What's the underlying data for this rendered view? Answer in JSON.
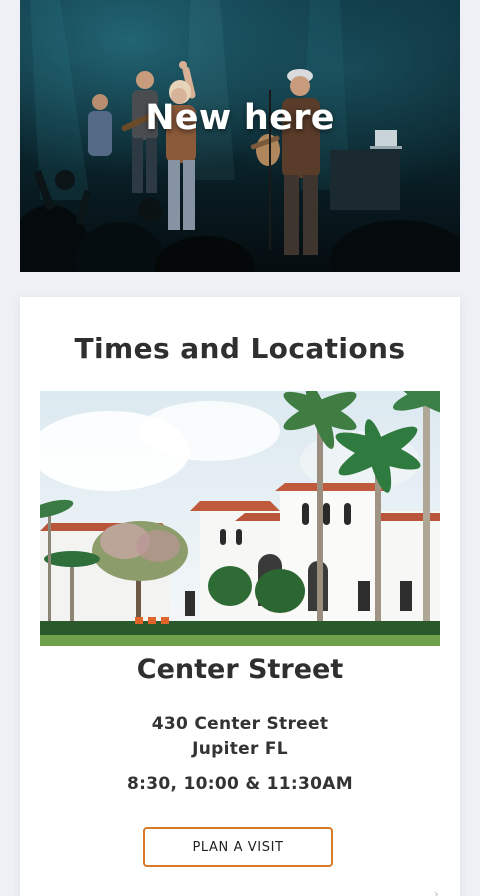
{
  "hero": {
    "title": "New here"
  },
  "locations_section": {
    "title": "Times and Locations",
    "location": {
      "name": "Center Street",
      "address_line1": "430 Center Street",
      "address_line2": "Jupiter FL",
      "service_times": "8:30, 10:00 & 11:30AM",
      "cta_label": "PLAN A VISIT"
    }
  },
  "colors": {
    "accent": "#d97a2b",
    "page_background": "#eef0f6",
    "heading_text": "#2f2f2f"
  },
  "icons": {
    "scroll_hint": "chevron-right-icon"
  }
}
